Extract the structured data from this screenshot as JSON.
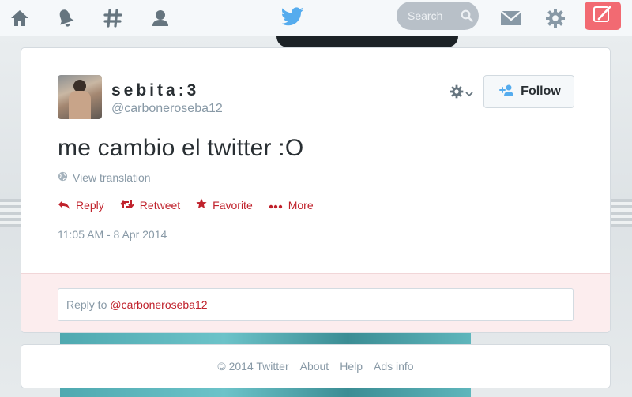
{
  "nav": {
    "icons": [
      "home-icon",
      "notifications-icon",
      "discover-icon",
      "me-icon"
    ],
    "logo": "twitter-bird-icon",
    "search_placeholder": "Search",
    "messages_icon": "envelope-icon",
    "settings_icon": "gear-icon",
    "compose_icon": "compose-quill-icon"
  },
  "tweet": {
    "fullname": "sebita:3",
    "screenname": "@carboneroseba12",
    "text": "me cambio el twitter :O",
    "translate_label": "View translation",
    "follow_label": "Follow",
    "actions": {
      "reply": "Reply",
      "retweet": "Retweet",
      "favorite": "Favorite",
      "more": "More"
    },
    "timestamp": "11:05 AM - 8 Apr 2014"
  },
  "reply_box": {
    "prefix": "Reply to",
    "mention": "@carboneroseba12"
  },
  "footer": {
    "copyright": "© 2014 Twitter",
    "links": [
      "About",
      "Help",
      "Ads info"
    ]
  },
  "colors": {
    "accent": "#c0222c",
    "compose_bg": "#f26a72",
    "twitter_blue": "#55acee",
    "muted_text": "#8899a6",
    "reply_area_bg": "#fcedee"
  }
}
